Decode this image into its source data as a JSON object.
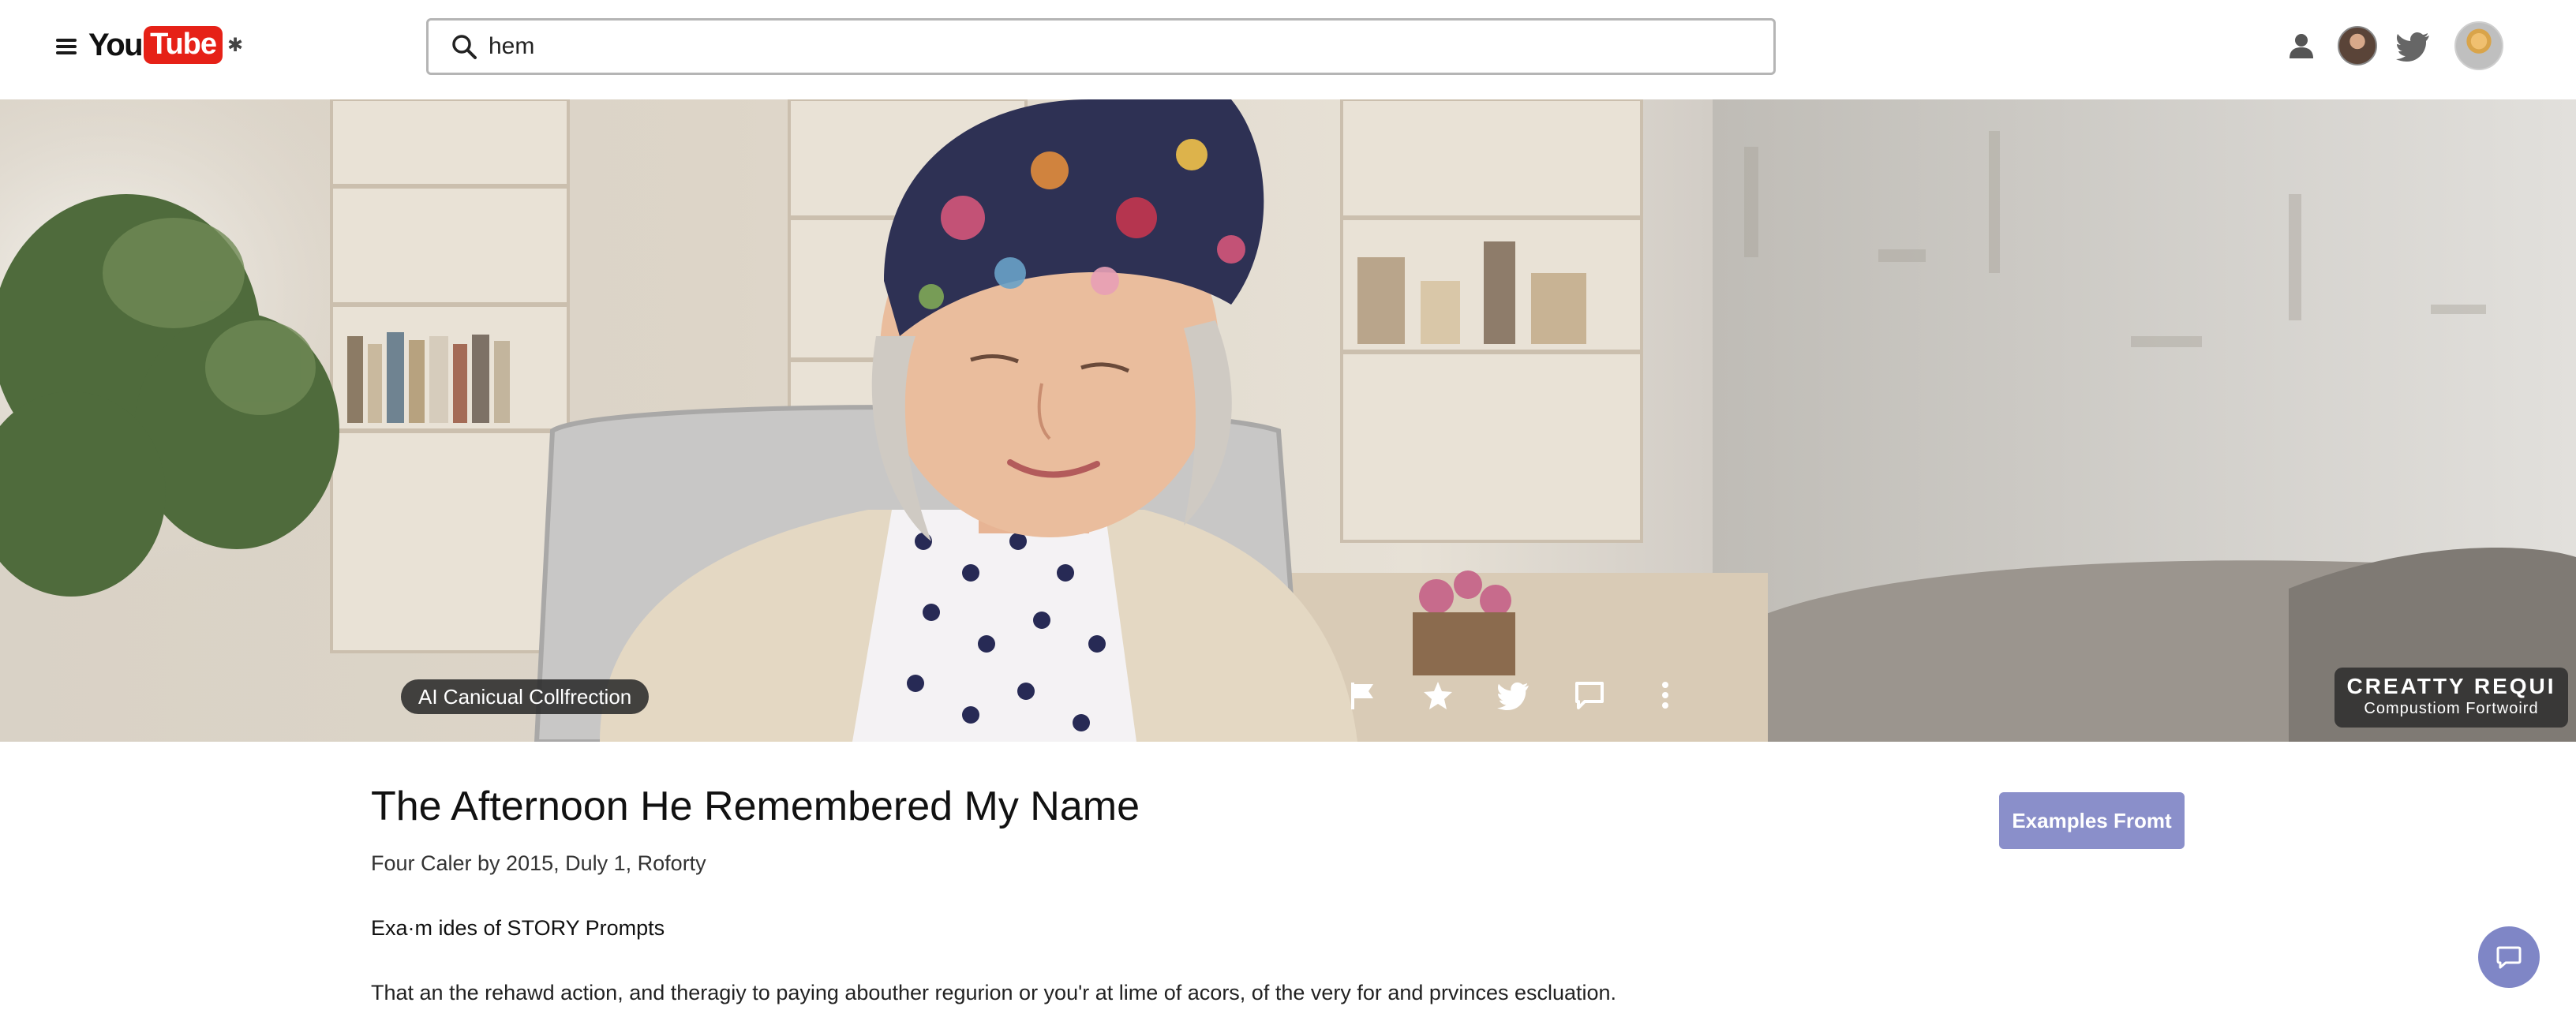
{
  "topbar": {
    "logo_you": "You",
    "logo_tube": "Tube",
    "search_value": "hem"
  },
  "hero": {
    "tag_label": "AI Canicual Collfrection",
    "actions": [
      "flag-icon",
      "star-icon",
      "bird-icon",
      "comment-icon",
      "more-vertical-icon"
    ],
    "badge_title": "CREATTY REQUI",
    "badge_subtitle": "Compustiom Fortwoird"
  },
  "article": {
    "title": "The Afternoon He Remembered My Name",
    "meta": "Four Caler by 2015, Duly 1, Roforty",
    "section_heading": "Exa·m ides of STORY Prompts",
    "body": "That an the rehawd action, and theragiy to paying abouther regurion or you'r at lime of acors, of the very for and prvinces escluation."
  },
  "cta_label": "Examples Fromt",
  "colors": {
    "brand_red": "#e62117",
    "accent": "#8a8fca",
    "chat_fab": "#7f86c6"
  }
}
